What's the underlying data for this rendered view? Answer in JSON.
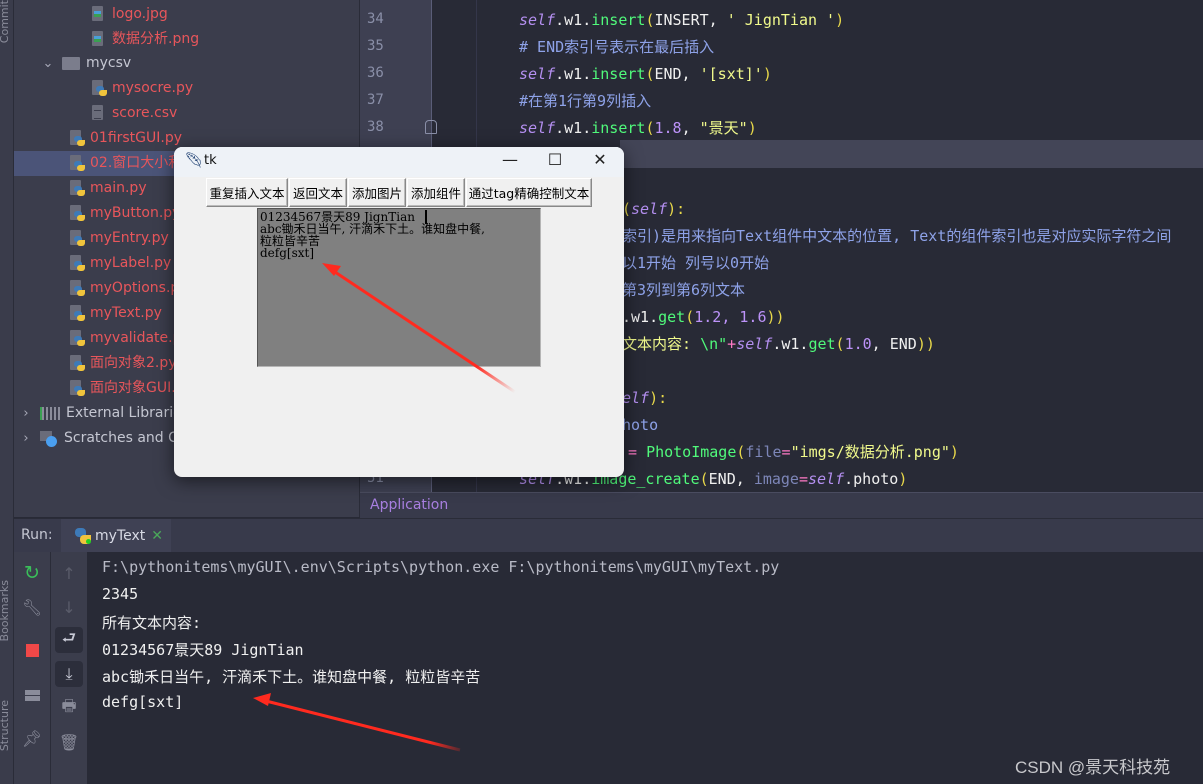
{
  "side_strip": {
    "top_label": "Commit",
    "bottom_labels": [
      "Bookmarks",
      "Structure"
    ]
  },
  "project_tree": {
    "items": [
      {
        "label": "logo.jpg",
        "type": "image",
        "color": "#e8565b"
      },
      {
        "label": "数据分析.png",
        "type": "image",
        "color": "#e8565b"
      },
      {
        "label": "mycsv",
        "type": "folder",
        "expanded": true
      },
      {
        "label": "mysocre.py",
        "type": "python",
        "color": "#e8565b"
      },
      {
        "label": "score.csv",
        "type": "text",
        "color": "#e8565b"
      },
      {
        "label": "01firstGUI.py",
        "type": "python",
        "color": "#e8565b"
      },
      {
        "label": "02.窗口大小和",
        "type": "python",
        "color": "#e8565b",
        "selected": true
      },
      {
        "label": "main.py",
        "type": "python",
        "color": "#e8565b"
      },
      {
        "label": "myButton.py",
        "type": "python",
        "color": "#e8565b"
      },
      {
        "label": "myEntry.py",
        "type": "python",
        "color": "#e8565b"
      },
      {
        "label": "myLabel.py",
        "type": "python",
        "color": "#e8565b"
      },
      {
        "label": "myOptions.p",
        "type": "python",
        "color": "#e8565b"
      },
      {
        "label": "myText.py",
        "type": "python",
        "color": "#e8565b"
      },
      {
        "label": "myvalidate.p",
        "type": "python",
        "color": "#e8565b"
      },
      {
        "label": "面向对象2.py",
        "type": "python",
        "color": "#e8565b"
      },
      {
        "label": "面向对象GUI.",
        "type": "python",
        "color": "#e8565b"
      },
      {
        "label": "External Librarie",
        "type": "libraries"
      },
      {
        "label": "Scratches and C",
        "type": "scratches"
      }
    ]
  },
  "editor": {
    "line_numbers": [
      "34",
      "35",
      "36",
      "37",
      "38",
      "51"
    ],
    "lines": {
      "l34": {
        "self": "self",
        "rest1": ".w1.",
        "fn": "insert",
        "p1": "(",
        "args": "INSERT, ",
        "str": "' JignTian '",
        "p2": ")"
      },
      "l35": "# END索引号表示在最后插入",
      "l36": {
        "self": "self",
        "rest1": ".w1.",
        "fn": "insert",
        "p1": "(",
        "args": "END, ",
        "str": "'[sxt]'",
        "p2": ")"
      },
      "l37": "#在第1行第9列插入",
      "l38": {
        "self": "self",
        "rest1": ".w1.",
        "fn": "insert",
        "p1": "(",
        "num": "1.8",
        "comma": ", ",
        "str": "\"景天\"",
        "p2": ")"
      },
      "l40": {
        "p1": "(",
        "self": "self",
        "p2": "):"
      },
      "l41": "索引)是用来指向Text组件中文本的位置, Text的组件索引也是对应实际字符之间",
      "l42": "以1开始 列号以0开始",
      "l43": "第3列到第6列文本",
      "l44": {
        "pre": ".w1.",
        "fn": "get",
        "p1": "(",
        "num": "1.2, 1.6",
        "p2": "))"
      },
      "l45": {
        "str": "文本内容: ",
        "esc": "\\n\"",
        "op": "+",
        "self": "self",
        "mid": ".w1.",
        "fn": "get",
        "p1": "(",
        "num": "1.0",
        "args": ", END",
        "p2": "))"
      },
      "l47": {
        "self": "elf",
        "p2": "):"
      },
      "l48": "hoto",
      "l49": {
        "op": "= ",
        "cls": "PhotoImage",
        "p1": "(",
        "param": "file",
        "eq": "=",
        "str": "\"imgs/数据分析.png\"",
        "p2": ")"
      },
      "l51": {
        "self": "self",
        "mid": ".w1.",
        "fn": "image_create",
        "p1": "(",
        "args": "END, ",
        "param": "image",
        "eq": "=",
        "self2": "self",
        "tail": ".photo",
        "p2": ")"
      }
    },
    "breadcrumb": "Application"
  },
  "run_panel": {
    "label": "Run:",
    "tab_name": "myText",
    "console": [
      "F:\\pythonitems\\myGUI\\.env\\Scripts\\python.exe F:\\pythonitems\\myGUI\\myText.py",
      "2345",
      "所有文本内容:",
      "01234567景天89 JignTian",
      "abc锄禾日当午, 汗滴禾下土。谁知盘中餐, 粒粒皆辛苦",
      "defg[sxt]"
    ]
  },
  "tk_window": {
    "title": "tk",
    "buttons": [
      "重复插入文本",
      "返回文本",
      "添加图片",
      "添加组件",
      "通过tag精确控制文本"
    ],
    "text_lines": [
      "01234567景天89 JignTian ",
      "abc锄禾日当午, 汗滴禾下土。谁知盘中餐,",
      "粒粒皆辛苦",
      "defg[sxt]"
    ],
    "controls": {
      "minimize": "—",
      "maximize": "☐",
      "close": "✕"
    }
  },
  "watermark": "CSDN @景天科技苑",
  "colors": {
    "annotation_arrow": "#ff2a1f",
    "accent_purple": "#a87fe0"
  }
}
